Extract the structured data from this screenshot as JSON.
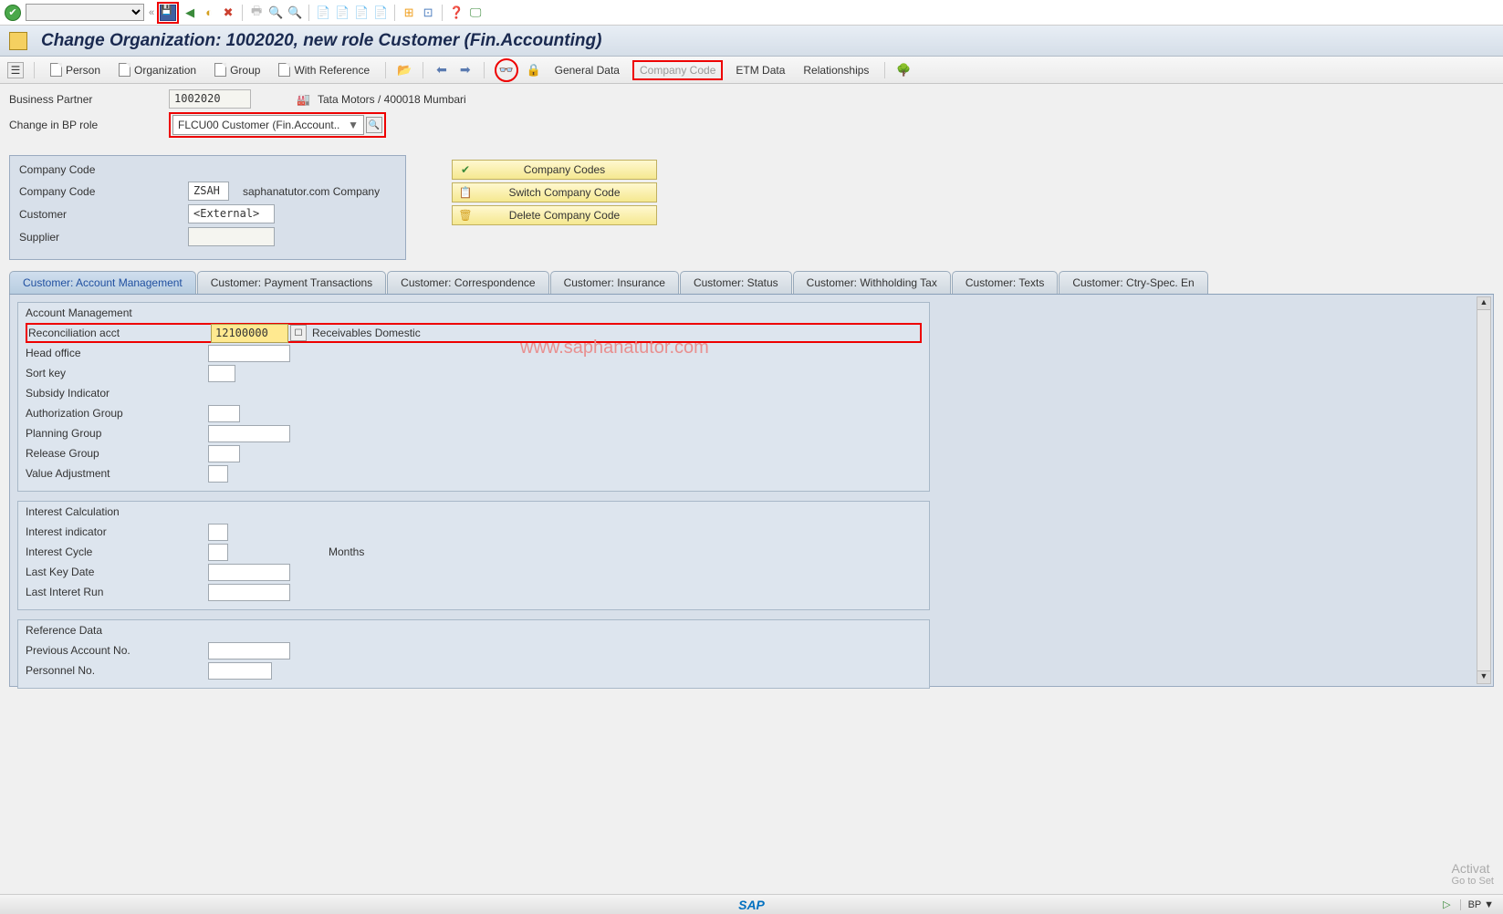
{
  "header": {
    "page_title": "Change Organization: 1002020, new role Customer (Fin.Accounting)"
  },
  "menu": {
    "person": "Person",
    "organization": "Organization",
    "group": "Group",
    "with_reference": "With Reference",
    "general_data": "General Data",
    "company_code": "Company Code",
    "etm_data": "ETM Data",
    "relationships": "Relationships"
  },
  "form": {
    "bp_label": "Business Partner",
    "bp_value": "1002020",
    "bp_desc": "Tata Motors / 400018 Mumbari",
    "role_label": "Change in BP role",
    "role_value": "FLCU00 Customer (Fin.Account.."
  },
  "company_code": {
    "section_title": "Company Code",
    "cc_label": "Company Code",
    "cc_value": "ZSAH",
    "cc_desc": "saphanatutor.com Company",
    "customer_label": "Customer",
    "customer_value": "<External>",
    "supplier_label": "Supplier",
    "btn_codes": "Company Codes",
    "btn_switch": "Switch Company Code",
    "btn_delete": "Delete Company Code"
  },
  "tabs": {
    "t0": "Customer: Account Management",
    "t1": "Customer: Payment Transactions",
    "t2": "Customer: Correspondence",
    "t3": "Customer: Insurance",
    "t4": "Customer: Status",
    "t5": "Customer: Withholding Tax",
    "t6": "Customer: Texts",
    "t7": "Customer: Ctry-Spec. En"
  },
  "acct_mgmt": {
    "title": "Account Management",
    "recon_label": "Reconciliation acct",
    "recon_value": "12100000",
    "recon_desc": "Receivables Domestic",
    "head_office": "Head office",
    "sort_key": "Sort key",
    "subsidy": "Subsidy Indicator",
    "auth_group": "Authorization Group",
    "planning_group": "Planning Group",
    "release_group": "Release Group",
    "value_adj": "Value Adjustment"
  },
  "interest": {
    "title": "Interest Calculation",
    "indicator": "Interest indicator",
    "cycle": "Interest Cycle",
    "cycle_unit": "Months",
    "last_key": "Last Key Date",
    "last_run": "Last Interet Run"
  },
  "reference": {
    "title": "Reference Data",
    "prev_acct": "Previous Account No.",
    "personnel": "Personnel No."
  },
  "watermark_text": "www.saphanatutor.com",
  "footer": {
    "activate": "Activat",
    "goto": "Go to Set",
    "sap": "SAP",
    "bp": "BP"
  }
}
